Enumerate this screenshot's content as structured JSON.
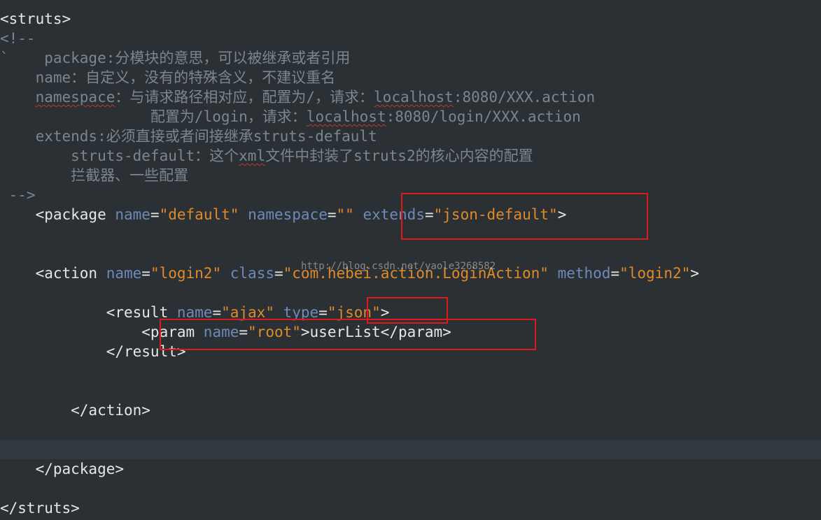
{
  "editor": {
    "lines": {
      "l1": "<struts>",
      "l2": "<!--",
      "l3": "`    package:分模块的意思，可以被继承或者引用",
      "l4a": "    name：自定义，没有的特殊含义，不建议重名",
      "l5_indent": "    ",
      "l5_ns": "namespace",
      "l5_mid": "：与请求路径相对应，配置为/，请求：",
      "l5_lh": "localhost",
      "l5_end": ":8080/XXX.action",
      "l6_pre": "                 配置为/login，请求：",
      "l6_lh": "localhost",
      "l6_end": ":8080/login/XXX.action",
      "l7": "    extends:必须直接或者间接继承struts-default",
      "l8_pre": "        struts-default：这个",
      "l8_xml": "xml",
      "l8_end": "文件中封装了struts2的核心内容的配置",
      "l9": "        拦截器、一些配置",
      "l10": " -->",
      "pkg_open": "    <package ",
      "pkg_name_attr": "name",
      "pkg_name_val": "\"default\"",
      "pkg_ns_attr": "namespace",
      "pkg_ns_val": "\"\"",
      "pkg_ext_attr": "extends",
      "pkg_ext_val": "\"json-default\"",
      "pkg_close": ">",
      "act_open": "    <action ",
      "act_name_attr": "name",
      "act_name_val": "\"login2\"",
      "act_class_attr": "class",
      "act_class_val": "\"com.hebei.action.LoginAction\"",
      "act_method_attr": "method",
      "act_method_val": "\"login2\"",
      "act_close": ">",
      "res_open": "            <result ",
      "res_name_attr": "name",
      "res_name_val": "\"ajax\"",
      "res_type_attr": "type",
      "res_type_val": "\"json\"",
      "res_close": ">",
      "param_open": "                <param ",
      "param_name_attr": "name",
      "param_name_val": "\"root\"",
      "param_body": ">userList</param>",
      "res_end": "            </result>",
      "act_end": "        </action>",
      "pkg_end": "    </package>",
      "struts_end": "</struts>"
    },
    "watermark": "http://blog.csdn.net/yaole3268582"
  }
}
